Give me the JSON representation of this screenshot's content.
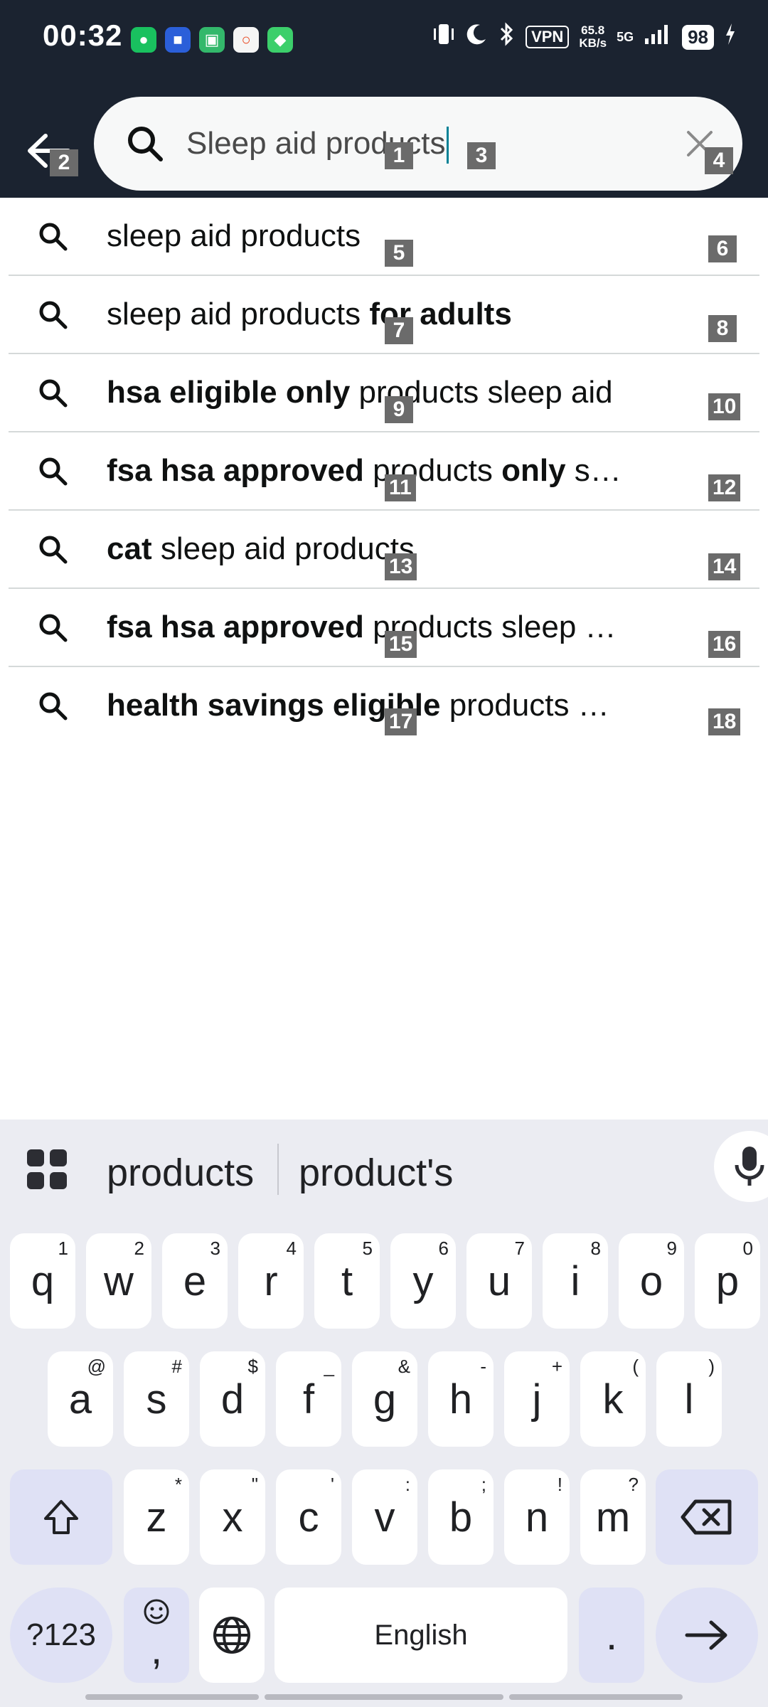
{
  "status_bar": {
    "time": "00:32",
    "vpn": "VPN",
    "speed_value": "65.8",
    "speed_unit": "KB/s",
    "network": "5G",
    "battery": "98"
  },
  "search": {
    "query": "Sleep aid products"
  },
  "suggestions": [
    {
      "parts": [
        {
          "t": "sleep aid products",
          "b": false
        }
      ]
    },
    {
      "parts": [
        {
          "t": "sleep aid products ",
          "b": false
        },
        {
          "t": "for adults",
          "b": true
        }
      ]
    },
    {
      "parts": [
        {
          "t": "hsa eligible only",
          "b": true
        },
        {
          "t": " products sleep aid",
          "b": false
        }
      ]
    },
    {
      "parts": [
        {
          "t": "fsa hsa approved",
          "b": true
        },
        {
          "t": " products ",
          "b": false
        },
        {
          "t": "only",
          "b": true
        },
        {
          "t": " s…",
          "b": false
        }
      ]
    },
    {
      "parts": [
        {
          "t": "cat",
          "b": true
        },
        {
          "t": " sleep aid products",
          "b": false
        }
      ]
    },
    {
      "parts": [
        {
          "t": "fsa hsa approved",
          "b": true
        },
        {
          "t": " products sleep …",
          "b": false
        }
      ]
    },
    {
      "parts": [
        {
          "t": "health savings eligible",
          "b": true
        },
        {
          "t": " products …",
          "b": false
        }
      ]
    }
  ],
  "tags": [
    "1",
    "2",
    "3",
    "4",
    "5",
    "6",
    "7",
    "8",
    "9",
    "10",
    "11",
    "12",
    "13",
    "14",
    "15",
    "16",
    "17",
    "18"
  ],
  "keyboard": {
    "suggestions": [
      "products",
      "product's"
    ],
    "row1": [
      {
        "k": "q",
        "h": "1"
      },
      {
        "k": "w",
        "h": "2"
      },
      {
        "k": "e",
        "h": "3"
      },
      {
        "k": "r",
        "h": "4"
      },
      {
        "k": "t",
        "h": "5"
      },
      {
        "k": "y",
        "h": "6"
      },
      {
        "k": "u",
        "h": "7"
      },
      {
        "k": "i",
        "h": "8"
      },
      {
        "k": "o",
        "h": "9"
      },
      {
        "k": "p",
        "h": "0"
      }
    ],
    "row2": [
      {
        "k": "a",
        "h": "@"
      },
      {
        "k": "s",
        "h": "#"
      },
      {
        "k": "d",
        "h": "$"
      },
      {
        "k": "f",
        "h": "_"
      },
      {
        "k": "g",
        "h": "&"
      },
      {
        "k": "h",
        "h": "-"
      },
      {
        "k": "j",
        "h": "+"
      },
      {
        "k": "k",
        "h": "("
      },
      {
        "k": "l",
        "h": ")"
      }
    ],
    "row3": [
      {
        "k": "z",
        "h": "*"
      },
      {
        "k": "x",
        "h": "\""
      },
      {
        "k": "c",
        "h": "'"
      },
      {
        "k": "v",
        "h": ":"
      },
      {
        "k": "b",
        "h": ";"
      },
      {
        "k": "n",
        "h": "!"
      },
      {
        "k": "m",
        "h": "?"
      }
    ],
    "symbols_key": "?123",
    "comma_key": ",",
    "space_label": "English",
    "period_key": "."
  }
}
